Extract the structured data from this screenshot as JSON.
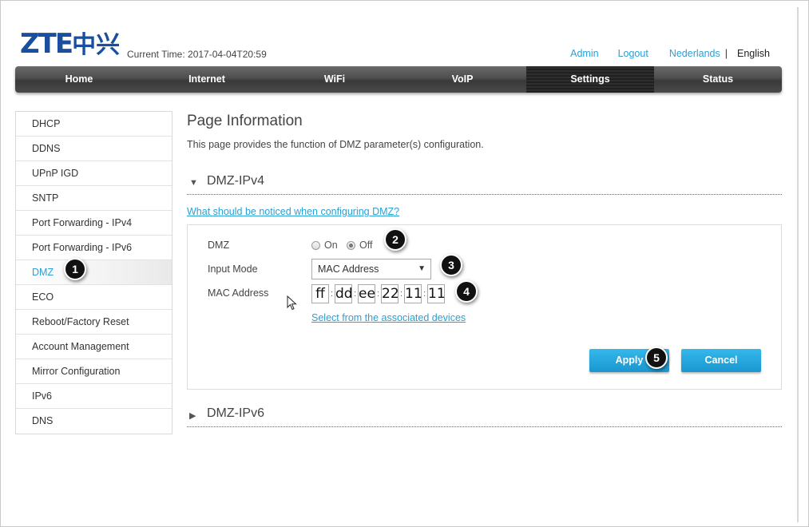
{
  "header": {
    "logo_text": "ZTE",
    "logo_cn": "中兴",
    "current_time_label": "Current Time: 2017-04-04T20:59",
    "links": {
      "admin": "Admin",
      "logout": "Logout",
      "lang_nl": "Nederlands",
      "lang_sep": "|",
      "lang_en": "English"
    }
  },
  "nav": {
    "items": [
      "Home",
      "Internet",
      "WiFi",
      "VoIP",
      "Settings",
      "Status"
    ],
    "active": "Settings"
  },
  "sidebar": {
    "items": [
      {
        "label": "DHCP"
      },
      {
        "label": "DDNS"
      },
      {
        "label": "UPnP IGD"
      },
      {
        "label": "SNTP"
      },
      {
        "label": "Port Forwarding - IPv4"
      },
      {
        "label": "Port Forwarding - IPv6"
      },
      {
        "label": "DMZ"
      },
      {
        "label": "ECO"
      },
      {
        "label": "Reboot/Factory Reset"
      },
      {
        "label": "Account Management"
      },
      {
        "label": "Mirror Configuration"
      },
      {
        "label": "IPv6"
      },
      {
        "label": "DNS"
      }
    ],
    "active": "DMZ"
  },
  "main": {
    "page_title": "Page Information",
    "page_desc": "This page provides the function of DMZ parameter(s) configuration.",
    "section_ipv4": {
      "title": "DMZ-IPv4",
      "expanded": true
    },
    "notice_link": "What should be noticed when configuring DMZ?",
    "form": {
      "dmz_label": "DMZ",
      "dmz_on_label": "On",
      "dmz_off_label": "Off",
      "dmz_value": "Off",
      "input_mode_label": "Input Mode",
      "input_mode_value": "MAC Address",
      "mac_label": "MAC Address",
      "mac_octets": [
        "ff",
        "dd",
        "ee",
        "22",
        "11",
        "11"
      ],
      "mac_sep": ":",
      "assoc_link": "Select from the associated devices",
      "apply_label": "Apply",
      "cancel_label": "Cancel"
    },
    "section_ipv6": {
      "title": "DMZ-IPv6",
      "expanded": false
    }
  },
  "callouts": [
    "1",
    "2",
    "3",
    "4",
    "5"
  ],
  "colors": {
    "accent": "#2aa0d4",
    "logo": "#1a4e9e",
    "button": "#1997cf",
    "navbar": "#4d4d4d"
  }
}
